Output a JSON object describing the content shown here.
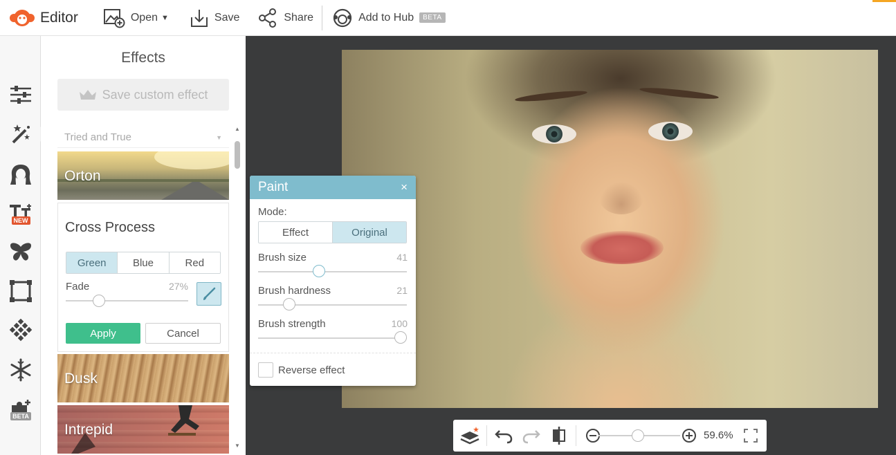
{
  "app": {
    "name": "Editor"
  },
  "toolbar": {
    "open_label": "Open",
    "save_label": "Save",
    "share_label": "Share",
    "hub_label": "Add to Hub",
    "hub_badge": "BETA"
  },
  "rail": {
    "text_badge": "NEW",
    "beta_badge": "BETA"
  },
  "effects": {
    "title": "Effects",
    "save_custom_label": "Save custom effect",
    "category": "Tried and True",
    "thumbs": [
      {
        "label": "Orton"
      },
      {
        "label": "Dusk"
      },
      {
        "label": "Intrepid"
      }
    ],
    "cross_process": {
      "title": "Cross Process",
      "options": [
        "Green",
        "Blue",
        "Red"
      ],
      "selected": "Green",
      "fade_label": "Fade",
      "fade_value": "27%",
      "apply_label": "Apply",
      "cancel_label": "Cancel"
    }
  },
  "paint": {
    "title": "Paint",
    "close_glyph": "×",
    "mode_label": "Mode:",
    "modes": [
      "Effect",
      "Original"
    ],
    "selected_mode": "Original",
    "sliders": [
      {
        "label": "Brush size",
        "value": "41",
        "fraction": 0.41
      },
      {
        "label": "Brush hardness",
        "value": "21",
        "fraction": 0.21
      },
      {
        "label": "Brush strength",
        "value": "100",
        "fraction": 1.0
      }
    ],
    "reverse_label": "Reverse effect"
  },
  "bottom": {
    "zoom_value": "59.6%",
    "zoom_fraction": 0.48
  },
  "colors": {
    "accent_blue": "#7fbccd",
    "apply_green": "#3fbf8c",
    "logo_orange": "#f0632d"
  }
}
